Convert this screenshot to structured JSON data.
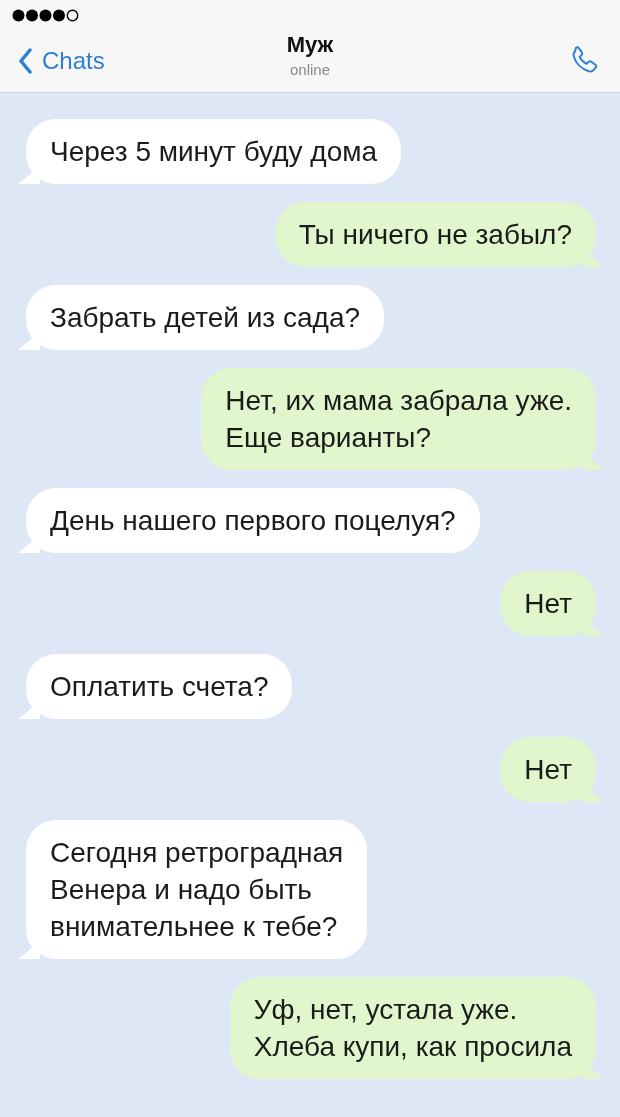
{
  "header": {
    "back_label": "Chats",
    "title": "Муж",
    "subtitle": "online"
  },
  "messages": [
    {
      "kind": "incoming",
      "text": "Через 5 минут буду дома"
    },
    {
      "kind": "outgoing",
      "text": "Ты ничего не забыл?"
    },
    {
      "kind": "incoming",
      "text": "Забрать детей из сада?"
    },
    {
      "kind": "outgoing",
      "text": "Нет, их мама забрала уже.\nЕще варианты?"
    },
    {
      "kind": "incoming",
      "text": "День нашего первого поцелуя?"
    },
    {
      "kind": "outgoing",
      "text": "Нет"
    },
    {
      "kind": "incoming",
      "text": "Оплатить счета?"
    },
    {
      "kind": "outgoing",
      "text": "Нет"
    },
    {
      "kind": "incoming",
      "text": "Сегодня ретроградная\nВенера и надо быть\nвнимательнее к тебе?"
    },
    {
      "kind": "outgoing",
      "text": "Уф, нет, устала уже.\nХлеба купи, как просила"
    }
  ]
}
